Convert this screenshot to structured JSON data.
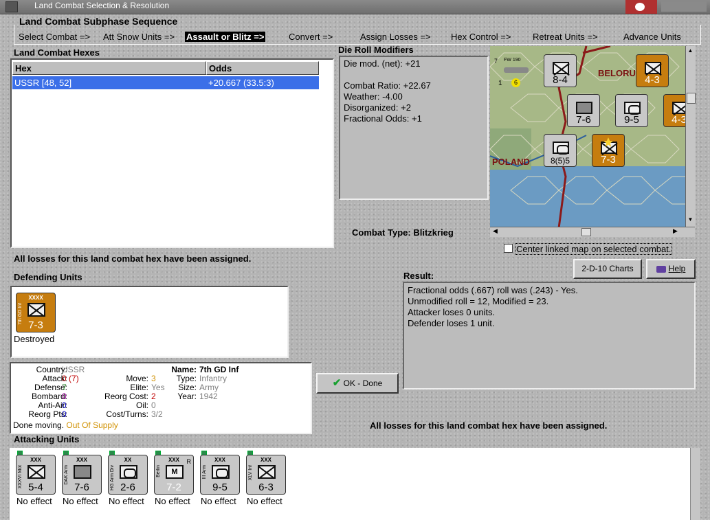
{
  "window": {
    "title": "Land Combat Selection & Resolution"
  },
  "sequence": {
    "title": "Land Combat Subphase Sequence",
    "steps": [
      "Select Combat =>",
      "Att Snow Units =>",
      "Assault or Blitz =>",
      "Convert =>",
      "Assign Losses =>",
      "Hex Control =>",
      "Retreat Units =>",
      "Advance Units"
    ],
    "current": "Assault or Blitz =>"
  },
  "hexes": {
    "title": "Land Combat Hexes",
    "columns": [
      "Hex",
      "Odds"
    ],
    "rows": [
      {
        "hex": "USSR [48, 52]",
        "odds": "+20.667 (33.5:3)"
      }
    ]
  },
  "modifiers": {
    "title": "Die Roll Modifiers",
    "lines": [
      "Die mod. (net): +21",
      "",
      "Combat Ratio: +22.67",
      "Weather: -4.00",
      "Disorganized: +2",
      "Fractional Odds: +1"
    ]
  },
  "combat_type": {
    "label": "Combat Type:",
    "value": "Blitzkrieg"
  },
  "center_map": {
    "label": "Center linked map on selected combat.",
    "checked": false
  },
  "buttons": {
    "charts": "2-D-10 Charts",
    "help": "Help",
    "ok": "OK - Done"
  },
  "losses_msg": "All losses for this land combat hex have been assigned.",
  "defending": {
    "title": "Defending Units",
    "units": [
      {
        "size": "XXXX",
        "name": "7th GD Inf",
        "value": "7-3",
        "status": "Destroyed",
        "color": "orange",
        "symbol": "cross"
      }
    ]
  },
  "result": {
    "title": "Result:",
    "lines": [
      "Fractional odds (.667) roll was (.243)  - Yes.",
      "Unmodified roll = 12, Modified = 23.",
      "Attacker loses 0 units.",
      "Defender loses 1 unit."
    ]
  },
  "unit_info": {
    "country_label": "Country:",
    "country": "USSR",
    "attack_label": "Attack:",
    "attack": "0",
    "attack_orig": "(7)",
    "defense_label": "Defense:",
    "defense": "7",
    "bombard_label": "Bombard:",
    "bombard": "0",
    "antiair_label": "Anti-Air:",
    "antiair": "0",
    "reorg_label": "Reorg Pts:",
    "reorg": "0",
    "move_label": "Move:",
    "move": "3",
    "elite_label": "Elite:",
    "elite": "Yes",
    "reorgcost_label": "Reorg Cost:",
    "reorgcost": "2",
    "oil_label": "Oil:",
    "oil": "0",
    "costturns_label": "Cost/Turns:",
    "costturns": "3/2",
    "name_label": "Name:",
    "name": "7th GD Inf",
    "type_label": "Type:",
    "type": "Infantry",
    "size_label": "Size:",
    "size": "Army",
    "year_label": "Year:",
    "year": "1942",
    "done_label": "Done moving.",
    "supply": "Out Of Supply"
  },
  "attacking": {
    "title": "Attacking Units",
    "units": [
      {
        "size": "XXX",
        "name": "XXXVI Mot",
        "value": "5-4",
        "status": "No effect",
        "symbol": "cross"
      },
      {
        "size": "XXX",
        "name": "DAK Arm",
        "value": "7-6",
        "status": "No effect",
        "symbol": "armor"
      },
      {
        "size": "XX",
        "name": "HG Arm Div",
        "value": "2-6",
        "status": "No effect",
        "symbol": "oval"
      },
      {
        "size": "XXX",
        "name": "Berlin",
        "value": "7-2",
        "status": "No effect",
        "symbol": "M",
        "extra": "R"
      },
      {
        "size": "XXX",
        "name": "III Arm",
        "value": "9-5",
        "status": "No effect",
        "symbol": "oval"
      },
      {
        "size": "XXX",
        "name": "XLV Inf",
        "value": "6-3",
        "status": "No effect",
        "symbol": "cross"
      }
    ]
  },
  "map": {
    "labels": [
      "BELORU",
      "POLAND"
    ],
    "counters": [
      {
        "value": "8-4",
        "color": "gray"
      },
      {
        "value": "4-3",
        "color": "orange"
      },
      {
        "value": "7-6",
        "color": "gray"
      },
      {
        "value": "9-5",
        "color": "gray"
      },
      {
        "value": "4-3",
        "color": "orange"
      },
      {
        "value": "8(5)5",
        "color": "gray"
      },
      {
        "value": "7-3",
        "color": "orange"
      }
    ],
    "plane": {
      "label": "FW 190",
      "top": "7",
      "bottom": "1",
      "badge": "6"
    }
  },
  "colors": {
    "selection": "#3b6fe8",
    "orange_counter": "#c67d0f",
    "gray_counter": "#c8c8c8",
    "value_red": "#c00000",
    "value_green": "#208020",
    "value_purple": "#a000a0",
    "value_blue": "#0000c0",
    "value_gray": "#808080",
    "supply_orange": "#d09000"
  }
}
